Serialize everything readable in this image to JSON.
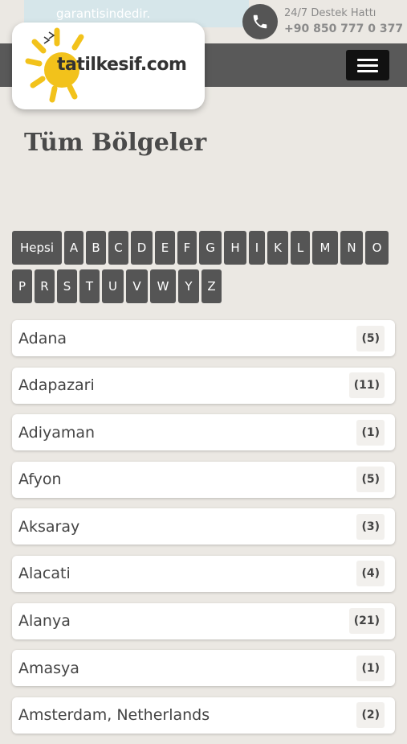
{
  "header": {
    "promo_text": "garantisindedir.",
    "support_label": "24/7 Destek Hattı",
    "support_phone": "+90 850 777 0 377",
    "logo_text": "tatilkesif.com",
    "menu_icon": "hamburger-icon",
    "phone_icon": "phone-icon"
  },
  "page": {
    "title": "Tüm Bölgeler"
  },
  "letters": {
    "row1": [
      "Hepsi",
      "A",
      "B",
      "C",
      "D",
      "E",
      "F",
      "G",
      "H",
      "I",
      "K",
      "L",
      "M",
      "N",
      "O"
    ],
    "row2": [
      "P",
      "R",
      "S",
      "T",
      "U",
      "V",
      "W",
      "Y",
      "Z"
    ]
  },
  "regions": [
    {
      "name": "Adana",
      "count": "(5)"
    },
    {
      "name": "Adapazari",
      "count": "(11)"
    },
    {
      "name": "Adiyaman",
      "count": "(1)"
    },
    {
      "name": "Afyon",
      "count": "(5)"
    },
    {
      "name": "Aksaray",
      "count": "(3)"
    },
    {
      "name": "Alacati",
      "count": "(4)"
    },
    {
      "name": "Alanya",
      "count": "(21)"
    },
    {
      "name": "Amasya",
      "count": "(1)"
    },
    {
      "name": "Amsterdam, Netherlands",
      "count": "(2)"
    }
  ],
  "colors": {
    "background": "#ebe8e3",
    "navbar": "#595959",
    "letter_button": "#555555",
    "logo_sun": "#f2c21b"
  }
}
